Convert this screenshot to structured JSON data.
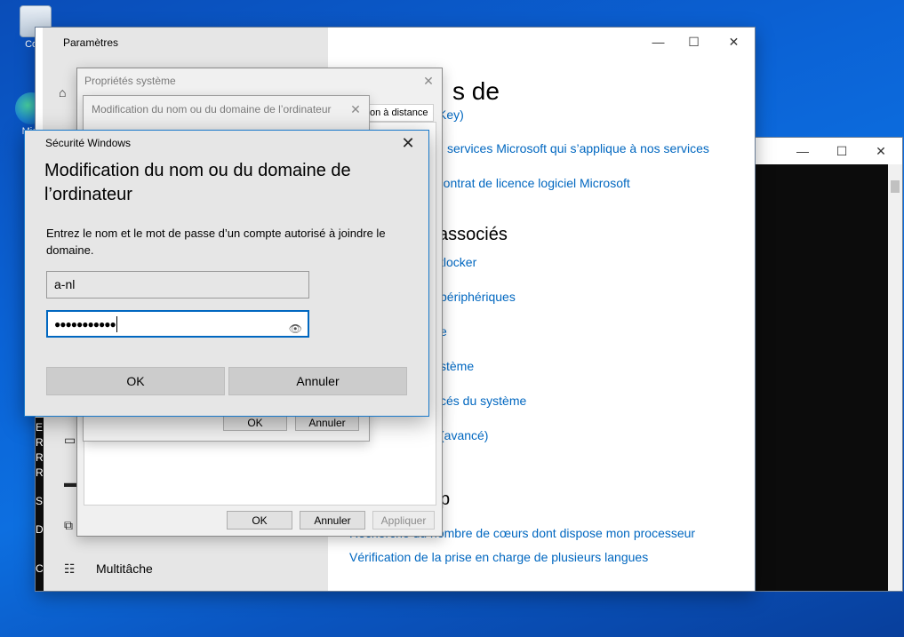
{
  "desktop": {
    "recycle_label": "Corb",
    "edge_label": "Micr"
  },
  "settings": {
    "title": "Paramètres",
    "heading": "s de",
    "related_heading": "associés",
    "bottom_heading": "p",
    "links": [
      "Key)",
      "services Microsoft qui s’applique à nos services",
      "u contrat de licence logiciel Microsoft",
      "tlocker",
      "périphériques",
      "e",
      "stème",
      "cés du système",
      "(avancé)",
      "Recherche du nombre de cœurs dont dispose mon processeur",
      "Vérification de la prise en charge de plusieurs langues"
    ],
    "nav": {
      "multitache": "Multitâche"
    },
    "left_letters": [
      "E",
      "R",
      "R",
      "R",
      "S",
      "D",
      "C"
    ]
  },
  "sysprops": {
    "title": "Propriétés système",
    "tab_remote": "on à distance",
    "ok": "OK",
    "cancel": "Annuler",
    "apply": "Appliquer"
  },
  "moddlg": {
    "title": "Modification du nom ou du domaine de l’ordinateur",
    "ok": "OK",
    "cancel": "Annuler"
  },
  "security": {
    "window_title": "Sécurité Windows",
    "heading": "Modification du nom ou du domaine de l’ordinateur",
    "description": "Entrez le nom et le mot de passe d’un compte autorisé à joindre le domaine.",
    "username_value": "a-nl",
    "password_value": "●●●●●●●●●●●",
    "ok": "OK",
    "cancel": "Annuler"
  },
  "colors": {
    "accent": "#0067c0",
    "desktop": "#0b63d6"
  }
}
